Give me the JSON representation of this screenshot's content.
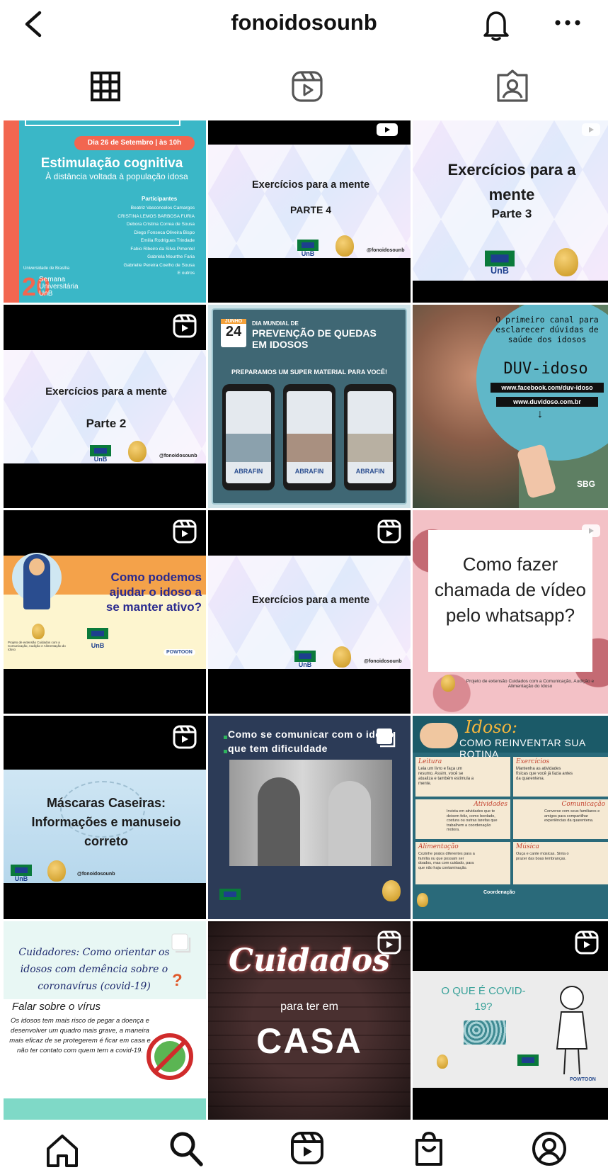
{
  "header": {
    "username": "fonoidosounb"
  },
  "posts": {
    "p1": {
      "date": "Dia 26 de Setembro | às 10h",
      "title": "Estimulação cognitiva",
      "subtitle": "À distância voltada à população idosa",
      "participants_label": "Participantes",
      "participants": [
        "Beatriz Vasconcelos Camargos",
        "CRISTINA LEMOS BARBOSA FURIA",
        "Debora Cristina Correa de Sousa",
        "Diego Fonseca Oliveira Bispo",
        "Emilia Rodrigues Trindade",
        "Fabio Ribeiro da Silva Pimentel",
        "Gabriela Mourthe Faria",
        "Gabrielle Pereira Coelho de Sousa",
        "E outros"
      ],
      "university": "Universidade de Brasília",
      "event": "Semana Universitária UnB",
      "event_number": "20"
    },
    "p2": {
      "title": "Exercícios para a mente",
      "part": "PARTE 4",
      "handle": "@fonoidosounb",
      "logo": "UnB"
    },
    "p3": {
      "title": "Exercícios para a mente",
      "part": "Parte 3",
      "logo": "UnB"
    },
    "p4": {
      "title": "Exercícios para a mente",
      "part": "Parte 2",
      "handle": "@fonoidosounb",
      "logo": "UnB"
    },
    "p5": {
      "month": "JUNHO",
      "day": "24",
      "line1": "DIA MUNDIAL DE",
      "line2": "PREVENÇÃO DE QUEDAS",
      "line3": "EM IDOSOS",
      "tagline": "PREPARAMOS UM SUPER MATERIAL PARA VOCÊ!",
      "brand": "ABRAFIN"
    },
    "p6": {
      "heading": "O primeiro canal para esclarecer dúvidas de saúde dos idosos",
      "brand": "DUV-idoso",
      "link1": "www.facebook.com/duv-idoso",
      "link2": "www.duvidoso.com.br",
      "arrow": "↓",
      "sbg": "SBG"
    },
    "p7": {
      "title": "Como podemos ajudar o idoso a se manter ativo?",
      "footer": "Projeto de extensão Cuidados com a Comunicação, Audição e Alimentação do Idoso",
      "logo": "UnB",
      "powtoon": "POWTOON"
    },
    "p8": {
      "title": "Exercícios para a mente",
      "handle": "@fonoidosounb",
      "logo": "UnB"
    },
    "p9": {
      "title": "Como fazer chamada de vídeo pelo whatsapp?",
      "footer": "Projeto de extensão Cuidados com a Comunicação, Audição e Alimentação do Idoso"
    },
    "p10": {
      "title": "Máscaras Caseiras: Informações e manuseio correto",
      "handle": "@fonoidosounb",
      "logo": "UnB"
    },
    "p11": {
      "title": "Como se comunicar com o idoso que tem dificuldade"
    },
    "p12": {
      "title": "Idoso:",
      "subtitle": "COMO REINVENTAR SUA ROTINA",
      "sections": [
        {
          "h": "Leitura",
          "t": "Leia um livro e faça um resumo. Assim, você se atualiza e também estimula a mente."
        },
        {
          "h": "Exercícios",
          "t": "Mantenha as atividades físicas que você já fazia antes da quarentena."
        },
        {
          "h": "Atividades",
          "t": "Invista em atividades que te deixem feliz, como bordado, costura ou outras tarefas que trabalhem a coordenação motora."
        },
        {
          "h": "Comunicação",
          "t": "Converse com seus familiares e amigos para compartilhar experiências da quarentena."
        },
        {
          "h": "Alimentação",
          "t": "Cozinhe pratos diferentes para a família ou que possam ser doados, mas com cuidado, para que não haja contaminação."
        },
        {
          "h": "Música",
          "t": "Ouça e cante músicas. Sinta o prazer das boas lembranças."
        }
      ],
      "footer": "Coordenação"
    },
    "p13": {
      "title": "Cuidadores: Como orientar os idosos com demência sobre o coronavírus (covid-19)",
      "subheading": "Falar sobre o vírus",
      "body": "Os idosos tem mais risco de pegar a doença e desenvolver um quadro mais grave, a maneira mais eficaz de se protegerem é ficar em casa e não ter contato com quem tem a covid-19."
    },
    "p14": {
      "line1": "Cuidados",
      "line2": "para ter em",
      "line3": "CASA"
    },
    "p15": {
      "title": "O QUE É COVID-19?",
      "powtoon": "POWTOON"
    }
  }
}
